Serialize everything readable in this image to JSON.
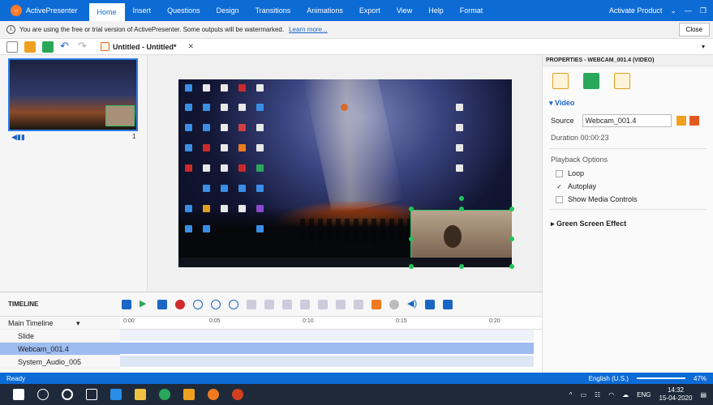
{
  "titlebar": {
    "app_name": "ActivePresenter",
    "menu": [
      "Home",
      "Insert",
      "Questions",
      "Design",
      "Transitions",
      "Animations",
      "Export",
      "View",
      "Help",
      "Format"
    ],
    "activate_label": "Activate Product"
  },
  "notice": {
    "text": "You are using the free or trial version of ActivePresenter. Some outputs will be watermarked.",
    "link": "Learn more...",
    "close_label": "Close"
  },
  "document": {
    "tab_label": "Untitled - Untitled*"
  },
  "slides": {
    "slide_number": "1"
  },
  "properties": {
    "header": "PROPERTIES - WEBCAM_001.4 (VIDEO)",
    "section_video": "Video",
    "source_label": "Source",
    "source_value": "Webcam_001.4",
    "duration": "Duration 00:00:23",
    "playback_label": "Playback Options",
    "loop_label": "Loop",
    "autoplay_label": "Autoplay",
    "show_controls_label": "Show Media Controls",
    "green_screen_label": "Green Screen Effect"
  },
  "timeline": {
    "title": "TIMELINE",
    "main_timeline": "Main Timeline",
    "ruler": [
      "0:00",
      "0:05",
      "0:10",
      "0:15",
      "0:20"
    ],
    "rows": [
      "Slide",
      "Webcam_001.4",
      "System_Audio_005"
    ]
  },
  "statusbar": {
    "left": "Ready",
    "language": "English (U.S.)",
    "zoom": "47%"
  },
  "taskbar": {
    "lang": "ENG",
    "time": "14:32",
    "date": "15-04-2020"
  }
}
